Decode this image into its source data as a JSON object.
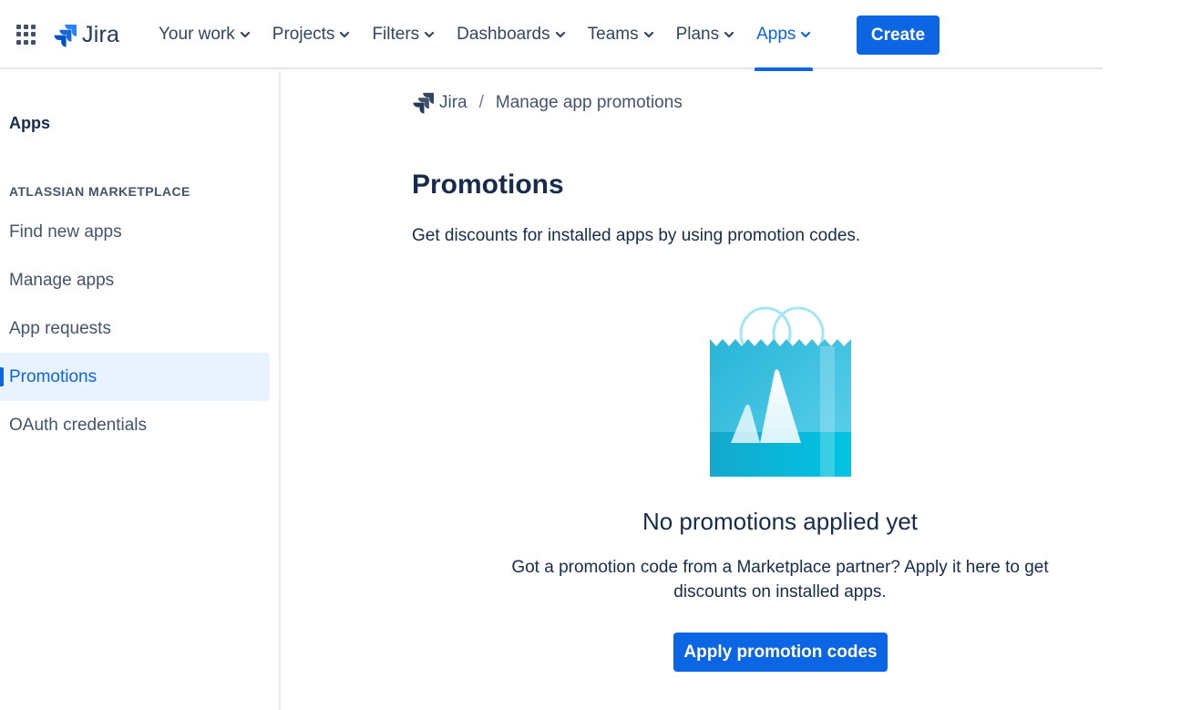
{
  "header": {
    "logo_text": "Jira",
    "nav": [
      {
        "label": "Your work"
      },
      {
        "label": "Projects"
      },
      {
        "label": "Filters"
      },
      {
        "label": "Dashboards"
      },
      {
        "label": "Teams"
      },
      {
        "label": "Plans"
      },
      {
        "label": "Apps",
        "active": true
      }
    ],
    "create_label": "Create"
  },
  "sidebar": {
    "title": "Apps",
    "section_heading": "ATLASSIAN MARKETPLACE",
    "items": [
      {
        "label": "Find new apps"
      },
      {
        "label": "Manage apps"
      },
      {
        "label": "App requests"
      },
      {
        "label": "Promotions",
        "selected": true
      },
      {
        "label": "OAuth credentials"
      }
    ]
  },
  "breadcrumb": {
    "root": "Jira",
    "separator": "/",
    "current": "Manage app promotions"
  },
  "main": {
    "title": "Promotions",
    "description": "Get discounts for installed apps by using promotion codes.",
    "empty_state": {
      "illustration": "shopping-bag-atlassian-icon",
      "title": "No promotions applied yet",
      "description": "Got a promotion code from a Marketplace partner? Apply it here to get discounts on installed apps.",
      "button_label": "Apply promotion codes"
    }
  },
  "colors": {
    "accent": "#0c66e4",
    "text": "#172b4d",
    "selected_bg": "#e9f2ff"
  }
}
